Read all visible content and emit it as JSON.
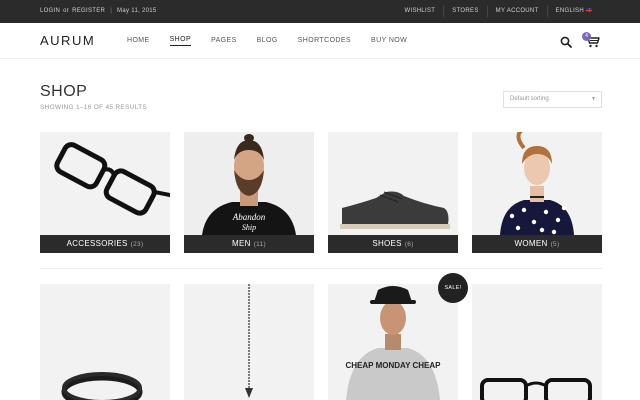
{
  "topbar": {
    "login": "LOGIN",
    "or": "or",
    "register": "REGISTER",
    "separator": "|",
    "date": "May 11, 2015",
    "links": [
      "WISHLIST",
      "STORES",
      "MY ACCOUNT",
      "ENGLISH"
    ]
  },
  "header": {
    "logo": "AURUM",
    "nav": [
      "HOME",
      "SHOP",
      "PAGES",
      "BLOG",
      "SHORTCODES",
      "BUY NOW"
    ],
    "active_nav": "SHOP",
    "cart_count": "4"
  },
  "shop": {
    "title": "SHOP",
    "result_count": "SHOWING 1–16 OF 45 RESULTS",
    "sort": "Default sorting"
  },
  "categories": [
    {
      "name": "ACCESSORIES",
      "count": "(23)"
    },
    {
      "name": "MEN",
      "count": "(11)"
    },
    {
      "name": "SHOES",
      "count": "(6)"
    },
    {
      "name": "WOMEN",
      "count": "(5)"
    }
  ],
  "products": {
    "sale_badge": "SALE!",
    "shirt_text": "CHEAP MONDAY CHEAP"
  },
  "colors": {
    "topbar_bg": "#2b2b2b",
    "label_bg": "#2b2b2b",
    "cart_badge": "#7b68b4",
    "tile_bg": "#f2f2f2"
  }
}
